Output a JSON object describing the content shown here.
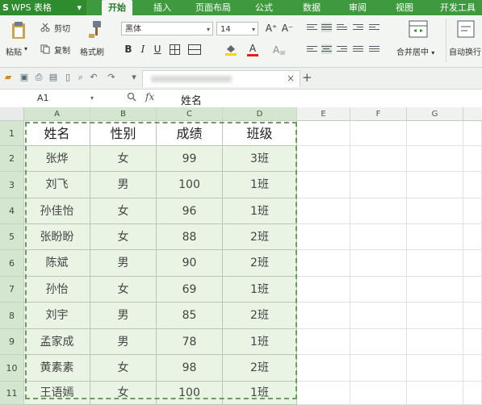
{
  "menubar": {
    "logo_s": "S",
    "logo_text": "WPS 表格",
    "logo_arrow": "▾",
    "items": [
      "开始",
      "插入",
      "页面布局",
      "公式",
      "数据",
      "审阅",
      "视图",
      "开发工具"
    ]
  },
  "ribbon": {
    "paste_label": "粘贴",
    "cut_label": "剪切",
    "copy_label": "复制",
    "format_painter_label": "格式刷",
    "font_name": "黑体",
    "font_size": "14",
    "bold": "B",
    "italic": "I",
    "underline": "U",
    "grow_font": "A⁺",
    "shrink_font": "A⁻",
    "font_color_letter": "A",
    "merge_center_label": "合并居中",
    "auto_wrap_label": "自动换行",
    "dropdown_arrow": "▾"
  },
  "quickbar": {
    "close": "×",
    "new_tab": "+"
  },
  "formula_bar": {
    "cell_ref": "A1",
    "fx": "fx",
    "content": "姓名"
  },
  "sheet": {
    "columns": [
      "A",
      "B",
      "C",
      "D",
      "E",
      "F",
      "G"
    ],
    "row_numbers": [
      "1",
      "2",
      "3",
      "4",
      "5",
      "6",
      "7",
      "8",
      "9",
      "10",
      "11"
    ],
    "headers": [
      "姓名",
      "性别",
      "成绩",
      "班级"
    ],
    "rows": [
      [
        "张烨",
        "女",
        "99",
        "3班"
      ],
      [
        "刘飞",
        "男",
        "100",
        "1班"
      ],
      [
        "孙佳怡",
        "女",
        "96",
        "1班"
      ],
      [
        "张盼盼",
        "女",
        "88",
        "2班"
      ],
      [
        "陈斌",
        "男",
        "90",
        "2班"
      ],
      [
        "孙怡",
        "女",
        "69",
        "1班"
      ],
      [
        "刘宇",
        "男",
        "85",
        "2班"
      ],
      [
        "孟家成",
        "男",
        "78",
        "1班"
      ],
      [
        "黄素素",
        "女",
        "98",
        "2班"
      ],
      [
        "王语嫣",
        "女",
        "100",
        "1班"
      ]
    ]
  },
  "colors": {
    "menubar": "#3f9a3f",
    "selected_fill": "#e9f4e5",
    "selection_border": "#6e9a64"
  }
}
